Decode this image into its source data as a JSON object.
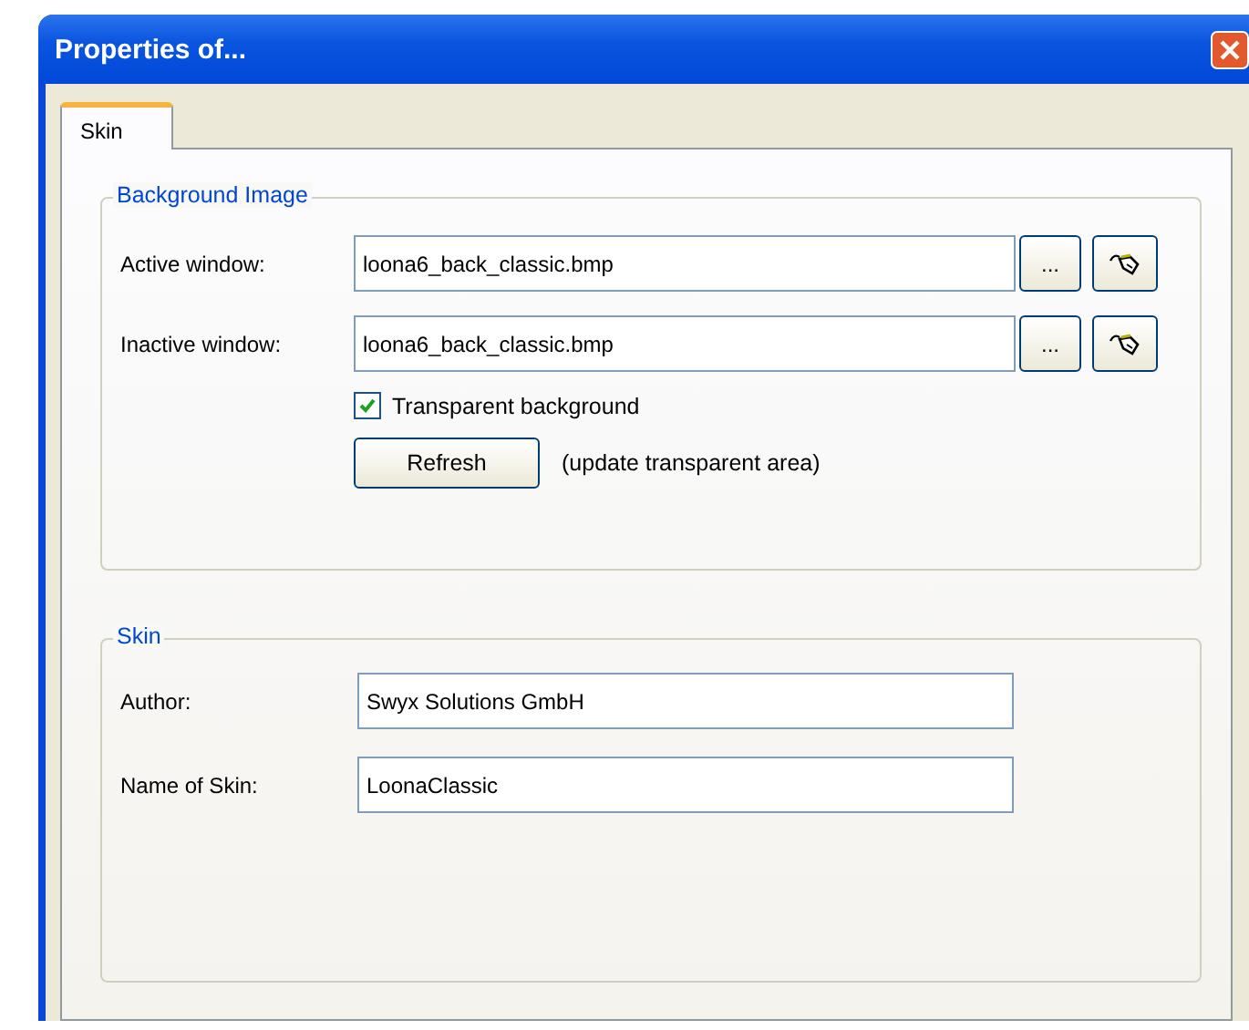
{
  "window": {
    "title": "Properties of..."
  },
  "tabs": [
    {
      "label": "Skin",
      "selected": true
    }
  ],
  "background_image": {
    "legend": "Background Image",
    "rows": [
      {
        "label": "Active window:",
        "value": "loona6_back_classic.bmp",
        "browse": "..."
      },
      {
        "label": "Inactive window:",
        "value": "loona6_back_classic.bmp",
        "browse": "..."
      }
    ],
    "transparent": {
      "label": "Transparent background",
      "checked": true
    },
    "refresh": {
      "button": "Refresh",
      "note": "(update transparent area)"
    }
  },
  "skin": {
    "legend": "Skin",
    "rows": [
      {
        "label": "Author:",
        "value": "Swyx Solutions GmbH"
      },
      {
        "label": "Name of Skin:",
        "value": "LoonaClassic"
      }
    ]
  }
}
